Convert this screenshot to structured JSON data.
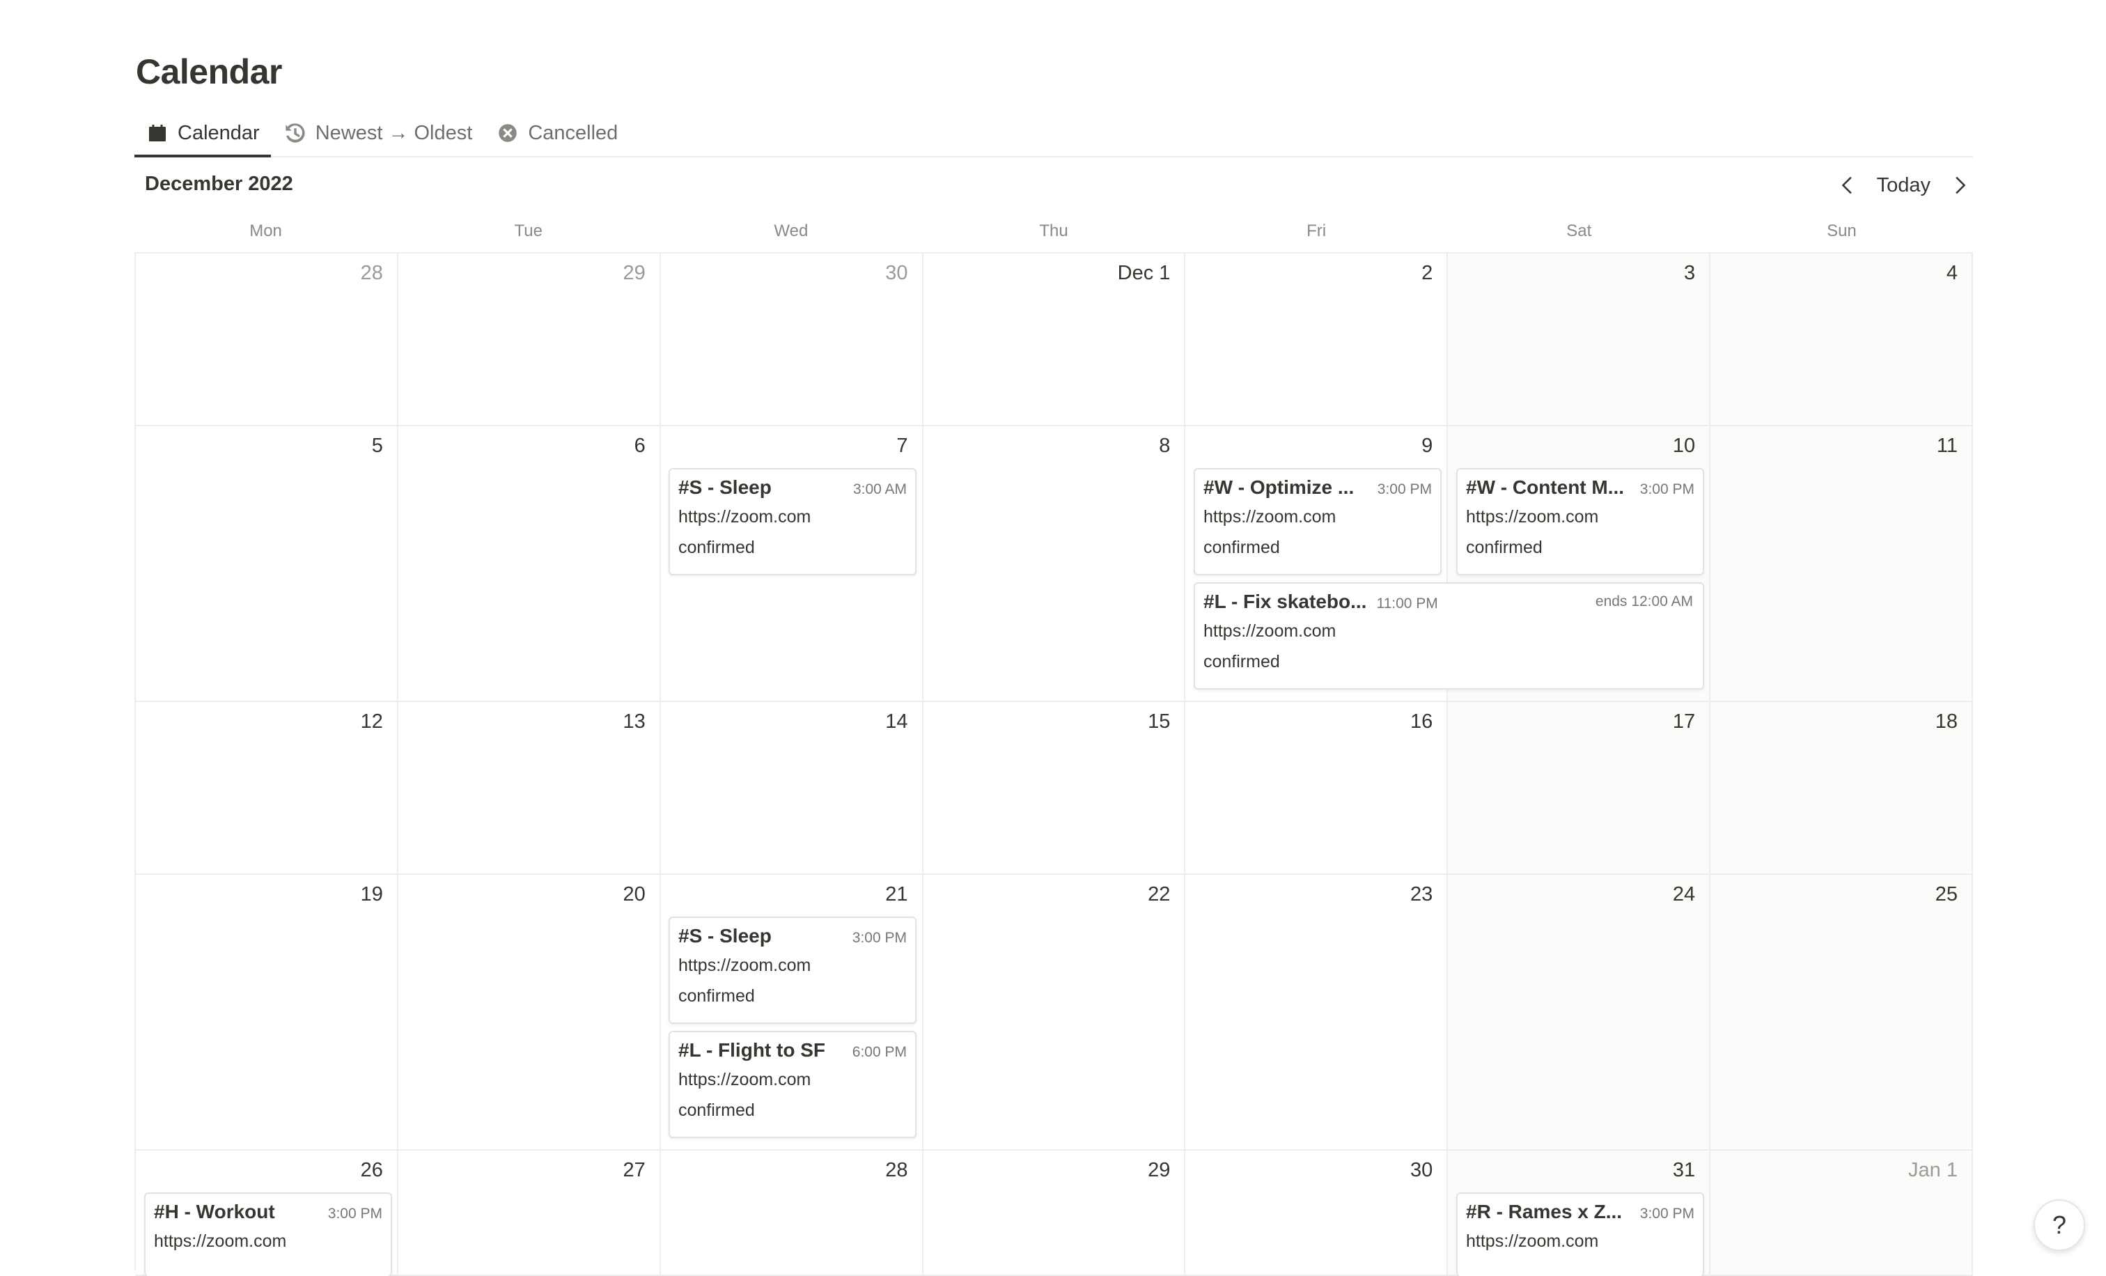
{
  "page": {
    "title": "Calendar"
  },
  "tabs": [
    {
      "label": "Calendar",
      "icon": "calendar-icon",
      "active": true
    },
    {
      "label": "Newest → Oldest",
      "icon": "history-icon",
      "active": false
    },
    {
      "label": "Cancelled",
      "icon": "x-circle-icon",
      "active": false
    }
  ],
  "header": {
    "month": "December 2022",
    "today_label": "Today"
  },
  "weekdays": [
    "Mon",
    "Tue",
    "Wed",
    "Thu",
    "Fri",
    "Sat",
    "Sun"
  ],
  "weeks": [
    {
      "days": [
        "28",
        "29",
        "30",
        "Dec 1",
        "2",
        "3",
        "4"
      ]
    },
    {
      "days": [
        "5",
        "6",
        "7",
        "8",
        "9",
        "10",
        "11"
      ]
    },
    {
      "days": [
        "12",
        "13",
        "14",
        "15",
        "16",
        "17",
        "18"
      ]
    },
    {
      "days": [
        "19",
        "20",
        "21",
        "22",
        "23",
        "24",
        "25"
      ]
    },
    {
      "days": [
        "26",
        "27",
        "28",
        "29",
        "30",
        "31",
        "Jan 1"
      ]
    }
  ],
  "events": [
    {
      "title": "#S - Sleep",
      "time": "3:00 AM",
      "url": "https://zoom.com",
      "status": "confirmed"
    },
    {
      "title": "#W - Optimize ...",
      "time": "3:00 PM",
      "url": "https://zoom.com",
      "status": "confirmed"
    },
    {
      "title": "#W - Content M...",
      "time": "3:00 PM",
      "url": "https://zoom.com",
      "status": "confirmed"
    },
    {
      "title": "#L - Fix skatebo...",
      "time": "11:00 PM",
      "ends": "ends 12:00 AM",
      "url": "https://zoom.com",
      "status": "confirmed"
    },
    {
      "title": "#S - Sleep",
      "time": "3:00 PM",
      "url": "https://zoom.com",
      "status": "confirmed"
    },
    {
      "title": "#L - Flight to SF",
      "time": "6:00 PM",
      "url": "https://zoom.com",
      "status": "confirmed"
    },
    {
      "title": "#H - Workout",
      "time": "3:00 PM",
      "url": "https://zoom.com",
      "status": ""
    },
    {
      "title": "#R - Rames x Z...",
      "time": "3:00 PM",
      "url": "https://zoom.com",
      "status": ""
    }
  ],
  "help": {
    "label": "?"
  },
  "colors": {
    "grid_line": "#ededec",
    "weekend_bg": "#fbfbfa",
    "text": "#37352f",
    "muted": "#9b9a97"
  }
}
